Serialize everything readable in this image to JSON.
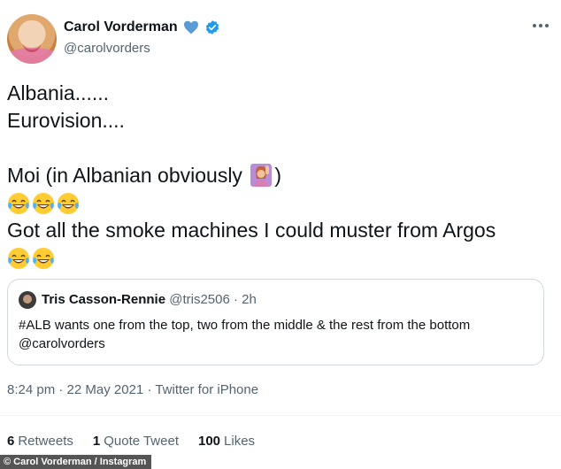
{
  "author": {
    "name": "Carol Vorderman",
    "handle": "@carolvorders"
  },
  "icons": {
    "heart_color": "#5b9bd5",
    "verified_color": "#1d9bf0"
  },
  "tweet": {
    "line1": "Albania......",
    "line2": "Eurovision....",
    "line3_before": "Moi (in Albanian obviously ",
    "line3_after": ")",
    "line4": "Got all the smoke machines I could muster from Argos"
  },
  "quote": {
    "name": "Tris Casson-Rennie",
    "meta": "@tris2506 · 2h",
    "text": "#ALB wants one from the top, two from the middle & the rest from the bottom @carolvorders"
  },
  "timestamp": {
    "time": "8:24 pm",
    "sep1": " · ",
    "date": "22 May 2021",
    "sep2": " · ",
    "source": "Twitter for iPhone"
  },
  "stats": {
    "retweets_count": "6",
    "retweets_label": "Retweets",
    "quotes_count": "1",
    "quotes_label": "Quote Tweet",
    "likes_count": "100",
    "likes_label": "Likes"
  },
  "credit": "© Carol Vorderman / Instagram"
}
